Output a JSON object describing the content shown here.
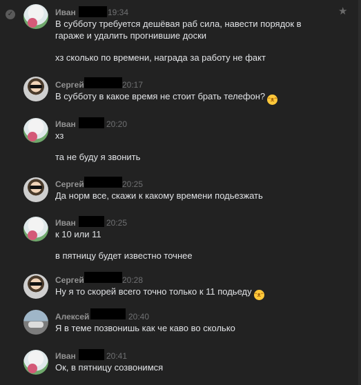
{
  "messages": [
    {
      "author": "Иван",
      "time": "19:34",
      "lines": [
        "В субботу требуется дешёвая раб сила, навести порядок в",
        "гараже и удалить прогнившие доски",
        "хз сколько по времени, награда за работу не факт"
      ]
    },
    {
      "author": "Сергей",
      "time": "20:17",
      "lines": [
        "В субботу в какое время не стоит брать телефон?"
      ],
      "emoji": "grinning-face"
    },
    {
      "author": "Иван",
      "time": "20:20",
      "lines": [
        "хз",
        "та не буду я звонить"
      ]
    },
    {
      "author": "Сергей",
      "time": "20:25",
      "lines": [
        "Да норм все, скажи к какому времени подьезжать"
      ]
    },
    {
      "author": "Иван",
      "time": "20:25",
      "lines": [
        "к 10 или 11",
        "в пятницу будет известно точнее"
      ]
    },
    {
      "author": "Сергей",
      "time": "20:28",
      "lines": [
        "Ну я то скорей всего точно только к 11 подьеду"
      ],
      "emoji": "grinning-face"
    },
    {
      "author": "Алексей",
      "time": "20:40",
      "lines": [
        "Я в теме позвонишь как че каво во сколько"
      ]
    },
    {
      "author": "Иван",
      "time": "20:41",
      "lines": [
        "Ок, в пятницу созвонимся"
      ]
    }
  ],
  "icons": {
    "selected": "check-icon",
    "favorite": "star-icon",
    "emoji": "grinning-face-emoji"
  }
}
